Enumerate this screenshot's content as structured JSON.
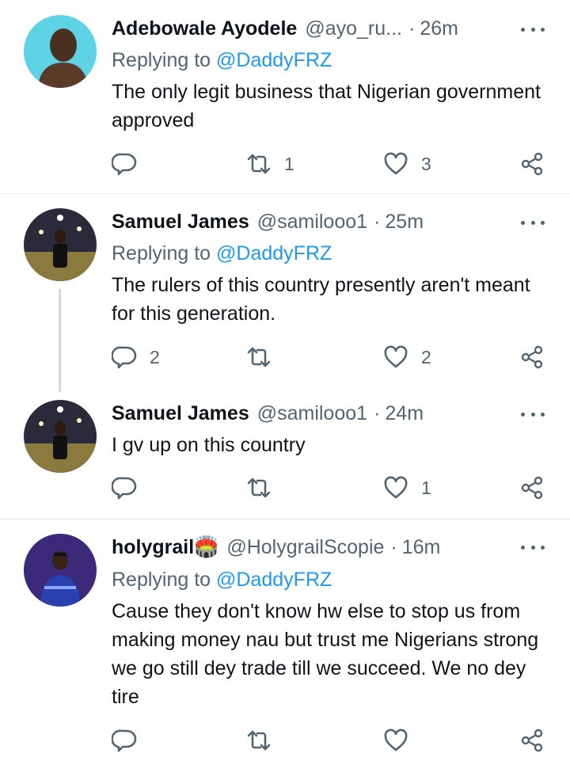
{
  "tweets": [
    {
      "name": "Adebowale Ayodele",
      "handle": "@ayo_ru...",
      "time": "26m",
      "replying_prefix": "Replying to ",
      "replying_to": "@DaddyFRZ",
      "text": "The only legit business that Nigerian government approved",
      "reply_count": "",
      "retweet_count": "1",
      "like_count": "3"
    },
    {
      "name": "Samuel James",
      "handle": "@samilooo1",
      "time": "25m",
      "replying_prefix": "Replying to ",
      "replying_to": "@DaddyFRZ",
      "text": "The rulers of this country presently aren't meant for this generation.",
      "reply_count": "2",
      "retweet_count": "",
      "like_count": "2"
    },
    {
      "name": "Samuel James",
      "handle": "@samilooo1",
      "time": "24m",
      "text": "I gv up on this country",
      "reply_count": "",
      "retweet_count": "",
      "like_count": "1"
    },
    {
      "name": "holygrail🏟️",
      "handle": "@HolygrailScopie",
      "time": "16m",
      "replying_prefix": "Replying to ",
      "replying_to": "@DaddyFRZ",
      "text": "Cause they don't know hw else to stop us from making money nau but trust me Nigerians strong we go still dey trade till we succeed. We no dey tire",
      "reply_count": "",
      "retweet_count": "",
      "like_count": ""
    }
  ],
  "separator": "·",
  "icons": {
    "reply": "reply-icon",
    "retweet": "retweet-icon",
    "like": "heart-icon",
    "share": "share-icon",
    "more": "more-options-icon"
  },
  "colors": {
    "text": "#0f1419",
    "secondary": "#536471",
    "link": "#1d9bf0",
    "divider": "#e7e9ea"
  }
}
